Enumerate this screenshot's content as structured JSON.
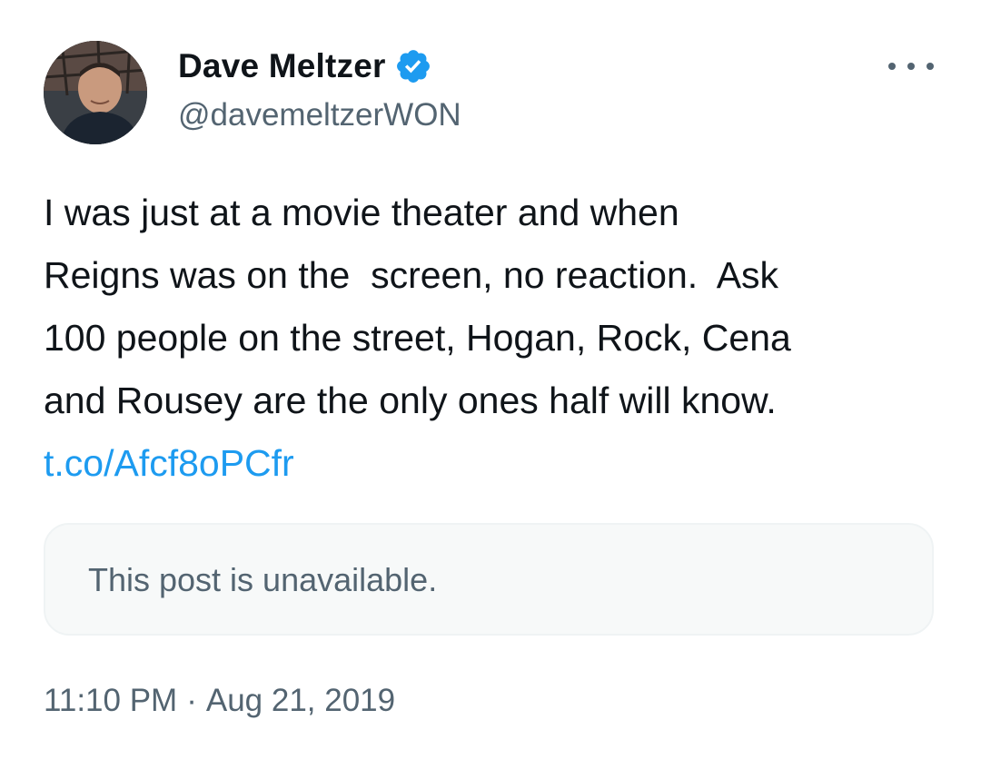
{
  "author": {
    "display_name": "Dave Meltzer",
    "handle": "@davemeltzerWON",
    "verified_icon": "verified-badge-icon",
    "avatar": "profile-photo"
  },
  "more_icon": "more-options-icon",
  "tweet": {
    "lines": [
      "I was just at a movie theater and when",
      "Reigns was on the  screen, no reaction.  Ask",
      "100 people on the street, Hogan, Rock, Cena",
      "and Rousey are the only ones half will know."
    ],
    "link": "t.co/Afcf8oPCfr"
  },
  "quoted": {
    "message": "This post is unavailable."
  },
  "meta": {
    "time": "11:10 PM",
    "separator": "·",
    "date": "Aug 21, 2019"
  },
  "colors": {
    "text": "#0f1419",
    "secondary": "#536471",
    "link": "#1d9bf0",
    "verified": "#1d9bf0",
    "card_bg": "#f7f9f9",
    "card_border": "#eff3f4"
  }
}
